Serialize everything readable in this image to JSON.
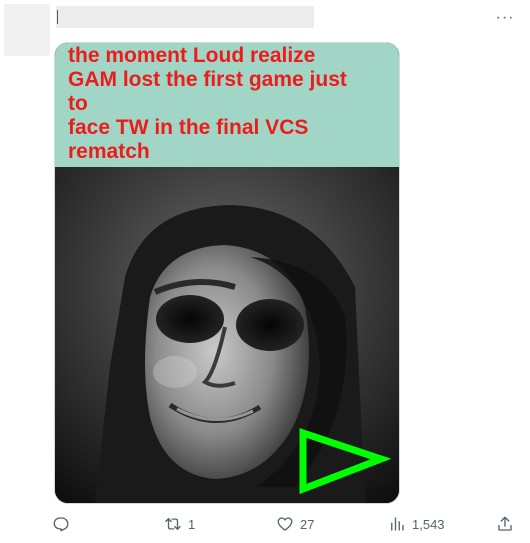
{
  "post": {
    "more_label": "···",
    "caption_lines": [
      "the moment Loud realize",
      "GAM lost the first game just",
      "to",
      "face TW in the final VCS",
      "rematch"
    ]
  },
  "actions": {
    "reply": {
      "icon": "reply-icon",
      "count": ""
    },
    "repost": {
      "icon": "repost-icon",
      "count": "1"
    },
    "like": {
      "icon": "heart-icon",
      "count": "27"
    },
    "views": {
      "icon": "views-chart-icon",
      "count": "1,543"
    },
    "share": {
      "icon": "share-icon",
      "count": ""
    }
  },
  "colors": {
    "caption_background": "#a1d6c6",
    "caption_text": "#ee1b1b",
    "play_triangle": "#00ff00",
    "action_icon": "#536471"
  }
}
